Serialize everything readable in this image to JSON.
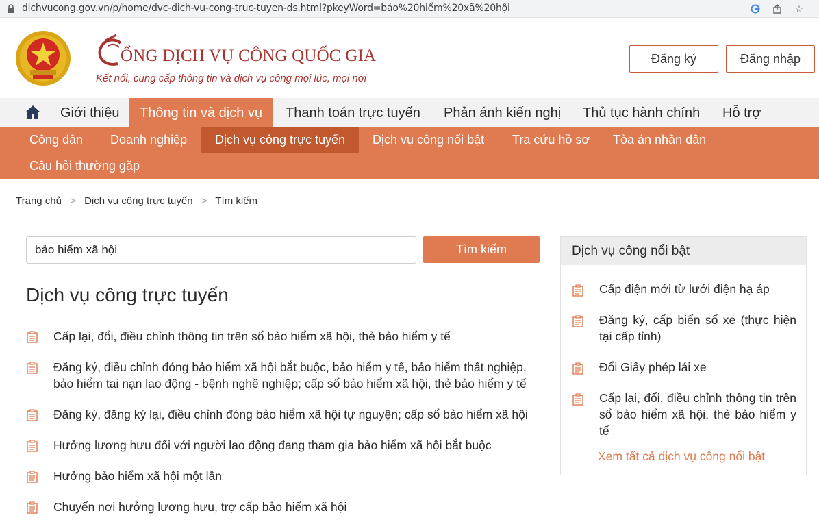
{
  "browser": {
    "url": "dichvucong.gov.vn/p/home/dvc-dich-vu-cong-truc-tuyen-ds.html?pkeyWord=bảo%20hiểm%20xã%20hội"
  },
  "header": {
    "title": "ỔNG DỊCH VỤ CÔNG QUỐC GIA",
    "slogan": "Kết nối, cung cấp thông tin và dịch vụ công mọi lúc, mọi nơi",
    "register": "Đăng ký",
    "login": "Đăng nhập"
  },
  "main_nav": {
    "items": [
      "Giới thiệu",
      "Thông tin và dịch vụ",
      "Thanh toán trực tuyến",
      "Phản ánh kiến nghị",
      "Thủ tục hành chính",
      "Hỗ trợ"
    ],
    "active": "Thông tin và dịch vụ"
  },
  "sub_nav": {
    "items": [
      "Công dân",
      "Doanh nghiệp",
      "Dịch vụ công trực tuyến",
      "Dịch vụ công nổi bật",
      "Tra cứu hồ sơ",
      "Tòa án nhân dân",
      "Câu hỏi thường gặp"
    ],
    "active": "Dịch vụ công trực tuyến"
  },
  "breadcrumb": {
    "items": [
      "Trang chủ",
      "Dịch vụ công trực tuyến",
      "Tìm kiếm"
    ],
    "separator": ">"
  },
  "search": {
    "value": "bảo hiểm xã hội",
    "button": "Tìm kiếm"
  },
  "results": {
    "title": "Dịch vụ công trực tuyến",
    "items": [
      "Cấp lại, đổi, điều chỉnh thông tin trên sổ bảo hiểm xã hội, thẻ bảo hiểm y tế",
      "Đăng ký, điều chỉnh đóng bảo hiểm xã hội bắt buộc, bảo hiểm y tế, bảo hiểm thất nghiệp, bảo hiểm tai nạn lao động - bệnh nghề nghiệp; cấp sổ bảo hiểm xã hội, thẻ bảo hiểm y tế",
      "Đăng ký, đăng ký lại, điều chỉnh đóng bảo hiểm xã hội tự nguyện; cấp sổ bảo hiểm xã hội",
      "Hưởng lương hưu đối với người lao động đang tham gia bảo hiểm xã hội bắt buộc",
      "Hưởng bảo hiểm xã hội một lần",
      "Chuyển nơi hưởng lương hưu, trợ cấp bảo hiểm xã hội"
    ]
  },
  "sidebar": {
    "title": "Dịch vụ công nổi bật",
    "items": [
      "Cấp điện mới từ lưới điện hạ áp",
      "Đăng ký, cấp biển số xe (thực hiện tại cấp tỉnh)",
      "Đổi Giấy phép lái xe",
      "Cấp lại, đổi, điều chỉnh thông tin trên sổ bảo hiểm xã hội, thẻ bảo hiểm y tế"
    ],
    "more": "Xem tất cả dịch vụ công nổi bật"
  },
  "colors": {
    "brand_red": "#a8322e",
    "accent_orange": "#e07a50",
    "accent_dark": "#c2582e"
  },
  "icons": {
    "document": "document-list-icon",
    "home": "home-icon",
    "lock": "lock-icon"
  }
}
